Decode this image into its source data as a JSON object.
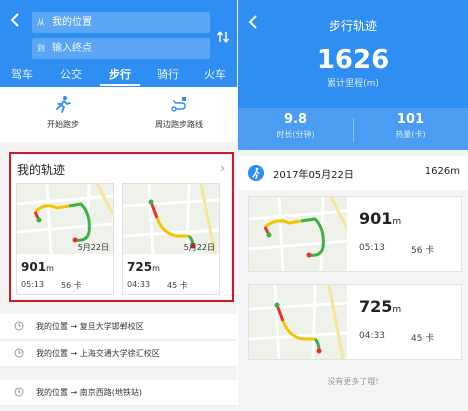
{
  "left": {
    "search": {
      "start_icon": "从",
      "start": "我的位置",
      "end_icon": "到",
      "end_placeholder": "输入终点"
    },
    "tabs": [
      "驾车",
      "公交",
      "步行",
      "骑行",
      "火车"
    ],
    "active_tab": "步行",
    "modes": [
      {
        "label": "开始跑步",
        "icon": "runner-icon"
      },
      {
        "label": "周边跑步路线",
        "icon": "route-icon"
      }
    ],
    "tracks": {
      "title": "我的轨迹",
      "items": [
        {
          "distance": "901",
          "unit": "m",
          "time": "05:13",
          "kcal": "56 卡",
          "date": "5月22日"
        },
        {
          "distance": "725",
          "unit": "m",
          "time": "04:33",
          "kcal": "45 卡",
          "date": "5月22日"
        }
      ]
    },
    "history": [
      {
        "from": "我的位置",
        "arrow": "→",
        "to": "复旦大学邯郸校区"
      },
      {
        "from": "我的位置",
        "arrow": "→",
        "to": "上海交通大学徐汇校区"
      },
      {
        "from": "我的位置",
        "arrow": "→",
        "to": "南京西路(地铁站)"
      }
    ]
  },
  "right": {
    "title": "步行轨迹",
    "total_value": "1626",
    "total_label": "累计里程(m)",
    "stats": [
      {
        "value": "9.8",
        "label": "时长(分钟)"
      },
      {
        "value": "101",
        "label": "热量(卡)"
      }
    ],
    "date_row": {
      "date": "2017年05月22日",
      "distance": "1626m"
    },
    "records": [
      {
        "distance": "901",
        "unit": "m",
        "time": "05:13",
        "kcal": "56 卡"
      },
      {
        "distance": "725",
        "unit": "m",
        "time": "04:33",
        "kcal": "45 卡"
      }
    ],
    "no_more": "没有更多了哦!"
  },
  "colors": {
    "primary": "#2f8ef1",
    "highlight": "#c91c24",
    "route_green": "#3cb043",
    "route_yellow": "#f5c400",
    "route_red": "#e8312c"
  }
}
